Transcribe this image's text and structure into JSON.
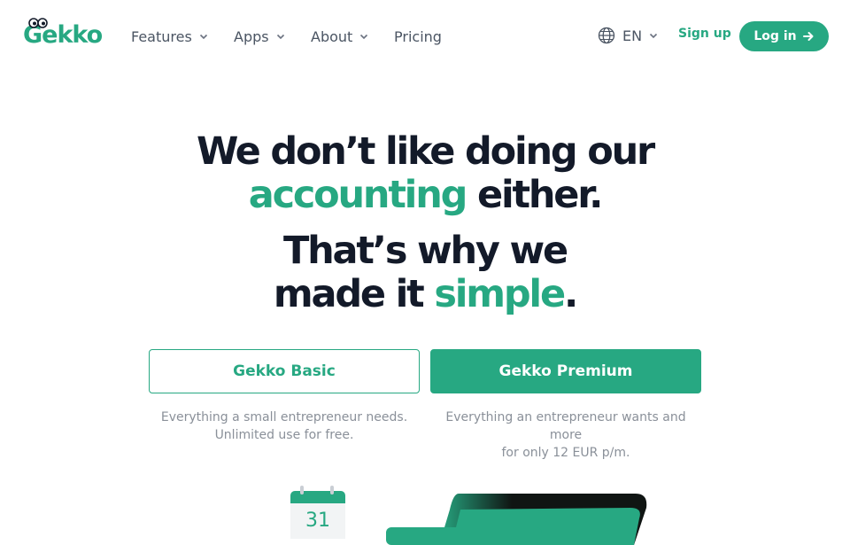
{
  "brand": {
    "name": "Gekko",
    "color": "#27a882"
  },
  "nav": {
    "items": [
      {
        "label": "Features",
        "has_dropdown": true
      },
      {
        "label": "Apps",
        "has_dropdown": true
      },
      {
        "label": "About",
        "has_dropdown": true
      },
      {
        "label": "Pricing",
        "has_dropdown": false
      }
    ],
    "language": {
      "label": "EN",
      "icon": "globe-icon"
    },
    "signup_label": "Sign up",
    "login_label": "Log in"
  },
  "hero": {
    "line1": "We don’t like doing our",
    "line2_accent": "accounting",
    "line2_rest": " either.",
    "line3": "That’s why we",
    "line4_start": "made it ",
    "line4_accent": "simple",
    "line4_end": "."
  },
  "plans": {
    "basic": {
      "label": "Gekko Basic",
      "desc_line1": "Everything a small entrepreneur needs.",
      "desc_line2": "Unlimited use for free."
    },
    "premium": {
      "label": "Gekko Premium",
      "desc_line1": "Everything an entrepreneur wants and more",
      "desc_line2": "for only 12 EUR p/m."
    }
  },
  "illustration": {
    "calendar_day": "31"
  }
}
